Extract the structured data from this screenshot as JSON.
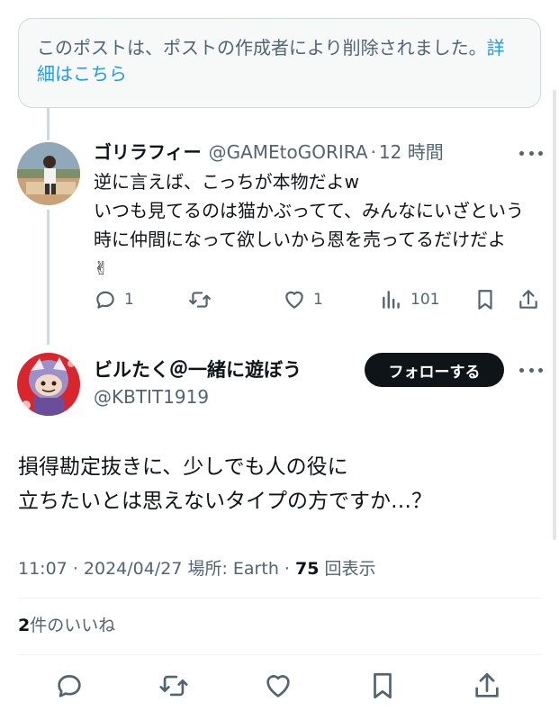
{
  "deleted_notice": {
    "text": "このポストは、ポストの作成者により削除されました。",
    "link": "詳細はこちら"
  },
  "reply": {
    "author_name": "ゴリラフィー",
    "handle": "@GAMEtoGORIRA",
    "separator": "·",
    "time": "12 時間",
    "body": "逆に言えば、こっちが本物だよw\nいつも見てるのは猫かぶってて、みんなにいざという時に仲間になって欲しいから恩を売ってるだけだよ ✌",
    "reply_count": "1",
    "like_count": "1",
    "view_count": "101"
  },
  "main_post": {
    "author_name": "ビルたく＠一緒に遊ぼう",
    "handle": "@KBTIT1919",
    "follow_label": "フォローする",
    "text": "損得勘定抜きに、少しでも人の役に\n立ちたいとは思えないタイプの方ですか…？",
    "time": "11:07",
    "date": "2024/04/27",
    "location_label": "場所: Earth",
    "views": "75",
    "views_label": "回表示",
    "meta_sep": "·",
    "likes_count": "2",
    "likes_label": "件のいいね"
  },
  "icons": [
    "more-icon",
    "reply-icon",
    "repost-icon",
    "like-icon",
    "views-icon",
    "bookmark-icon",
    "share-icon"
  ],
  "colors": {
    "link": "#1d9bf0",
    "muted": "#536471",
    "text": "#0f1419",
    "follow_bg": "#0f1419"
  }
}
